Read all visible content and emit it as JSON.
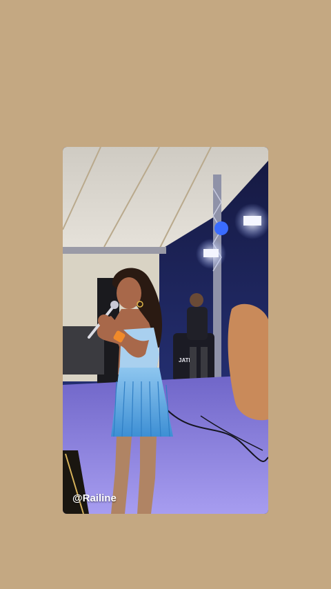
{
  "story": {
    "background_color": "#c4a882",
    "mention_text": "@Railine"
  },
  "media": {
    "kind": "photo",
    "subject": "singer-on-stage",
    "stage_sign_text": "JATEK"
  },
  "icons": {
    "mention": "at-sign"
  },
  "colors": {
    "tent": "#d8d4cc",
    "stage_floor": "#8a7fd6",
    "dress": "#5aa8e0",
    "night_sky": "#1c2050",
    "stage_light": "#f4f6ff"
  }
}
